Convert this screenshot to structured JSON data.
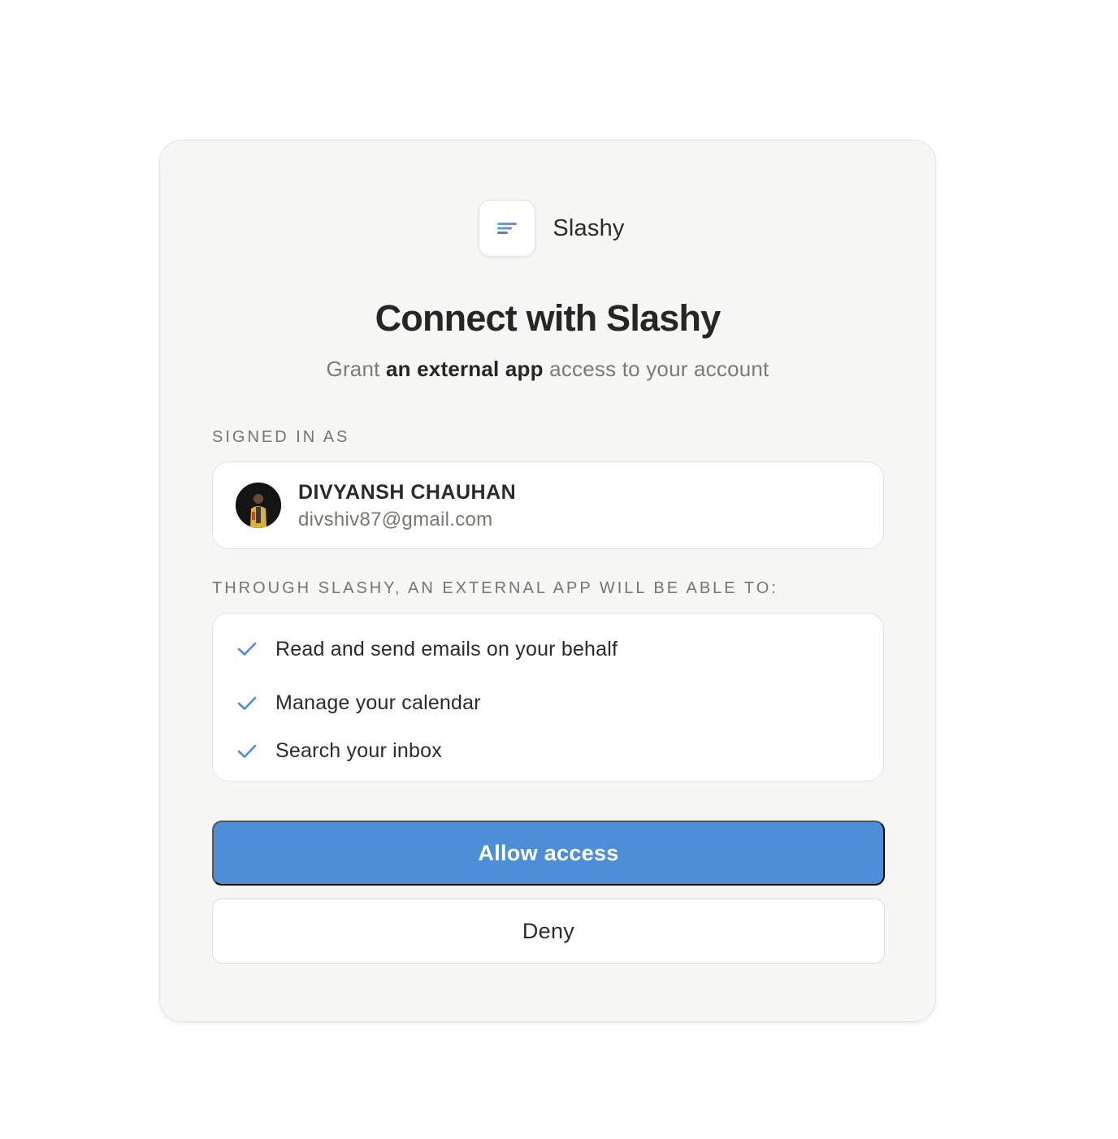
{
  "app": {
    "name": "Slashy",
    "logo_icon": "slashy-logo-icon"
  },
  "heading": {
    "title": "Connect with Slashy",
    "subtitle_prefix": "Grant",
    "subtitle_emphasis": "an external app",
    "subtitle_suffix": "access to your account"
  },
  "signed_in": {
    "label": "SIGNED IN AS",
    "name": "DIVYANSH CHAUHAN",
    "email": "divshiv87@gmail.com"
  },
  "permissions": {
    "label": "THROUGH SLASHY, AN EXTERNAL APP WILL BE ABLE TO:",
    "items": [
      "Read and send emails on your behalf",
      "Manage your calendar",
      "Search your inbox"
    ]
  },
  "actions": {
    "allow_label": "Allow access",
    "deny_label": "Deny"
  },
  "colors": {
    "accent": "#4c8fd8",
    "check": "#4c8fd8",
    "card_bg": "#f6f6f5"
  }
}
